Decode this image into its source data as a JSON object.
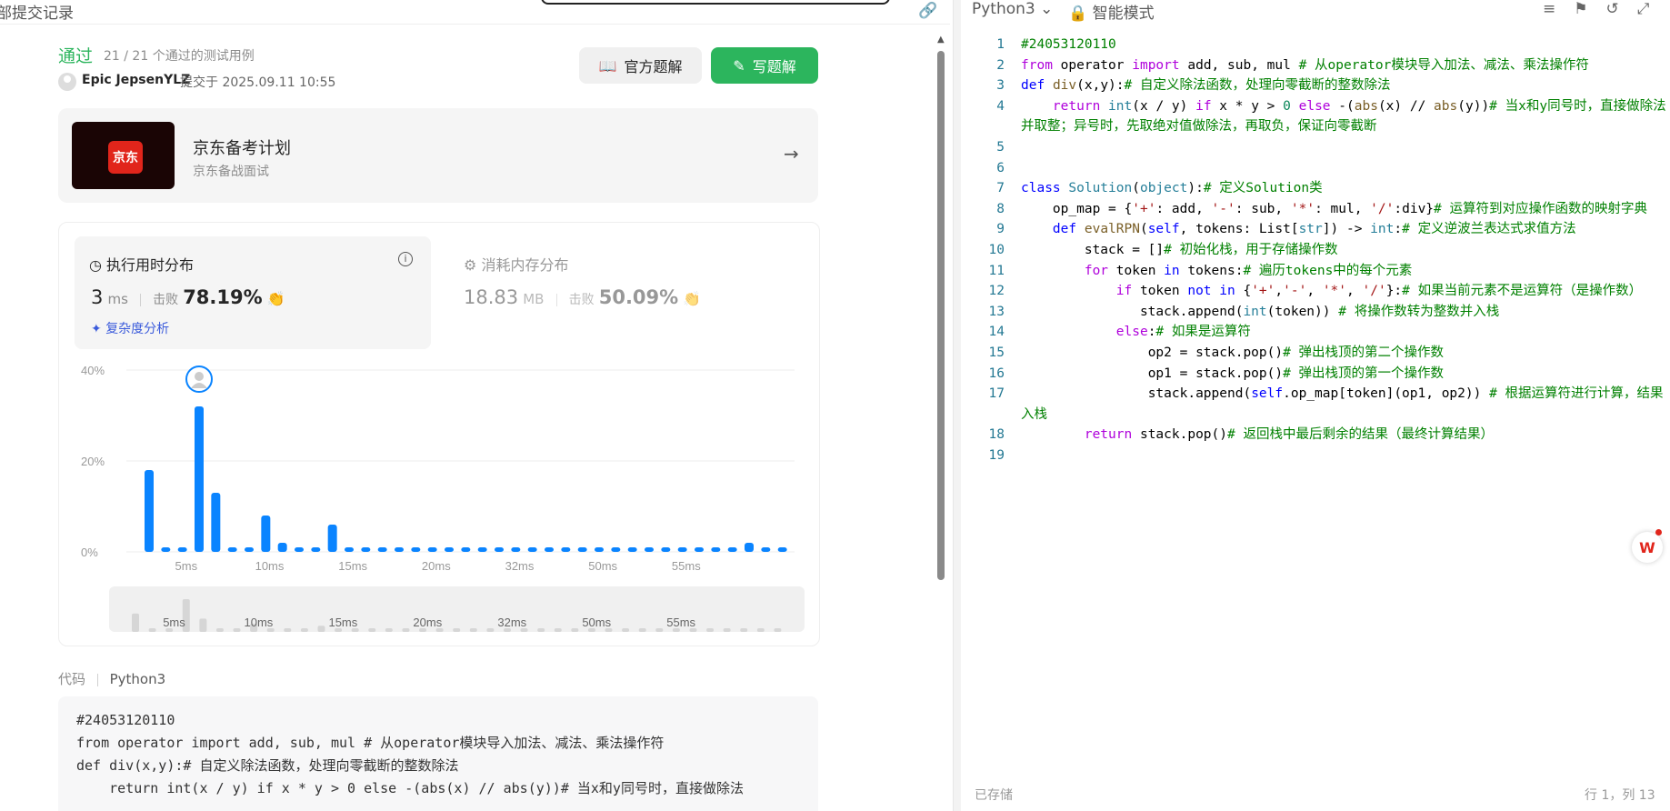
{
  "left_header": {
    "title": "部提交记录",
    "link_icon": "link-icon"
  },
  "submission": {
    "status": "通过",
    "testcases": "21 / 21 个通过的测试用例",
    "user": "Epic JepsenYLZ",
    "submitted": "提交于 2025.09.11 10:55",
    "official_solution": "官方题解",
    "write_solution": "写题解"
  },
  "promo": {
    "logo_text": "京东",
    "title": "京东备考计划",
    "subtitle": "京东备战面试"
  },
  "runtime": {
    "heading": "执行用时分布",
    "value": "3",
    "unit": "ms",
    "beat_label": "击败",
    "beat_value": "78.19%",
    "complexity": "复杂度分析"
  },
  "memory": {
    "heading": "消耗内存分布",
    "value": "18.83",
    "unit": "MB",
    "beat_label": "击败",
    "beat_value": "50.09%"
  },
  "chart_data": {
    "type": "bar",
    "ytick_labels": [
      "40%",
      "20%",
      "0%"
    ],
    "ylim": [
      0,
      40
    ],
    "xtick_labels": [
      "5ms",
      "10ms",
      "15ms",
      "20ms",
      "32ms",
      "50ms",
      "55ms"
    ],
    "values": [
      18,
      1,
      1,
      32,
      13,
      1,
      1,
      8,
      2,
      1,
      1,
      6,
      1,
      1,
      1,
      1,
      1,
      1,
      1,
      1,
      1,
      1,
      1,
      1,
      1,
      1,
      1,
      1,
      1,
      1,
      1,
      1,
      1,
      1,
      1,
      1,
      2,
      1,
      1
    ],
    "highlight_index": 3,
    "color": "#0a84ff"
  },
  "code_section": {
    "label": "代码",
    "lang": "Python3"
  },
  "code_preview": [
    "#24053120110",
    "from operator import add, sub, mul # 从operator模块导入加法、减法、乘法操作符",
    "def div(x,y):# 自定义除法函数，处理向零截断的整数除法",
    "    return int(x / y) if x * y > 0 else -(abs(x) // abs(y))# 当x和y同号时，直接做除法"
  ],
  "editor": {
    "language": "Python3",
    "mode": "智能模式",
    "saved": "已存储",
    "position": "行 1，列 13"
  }
}
